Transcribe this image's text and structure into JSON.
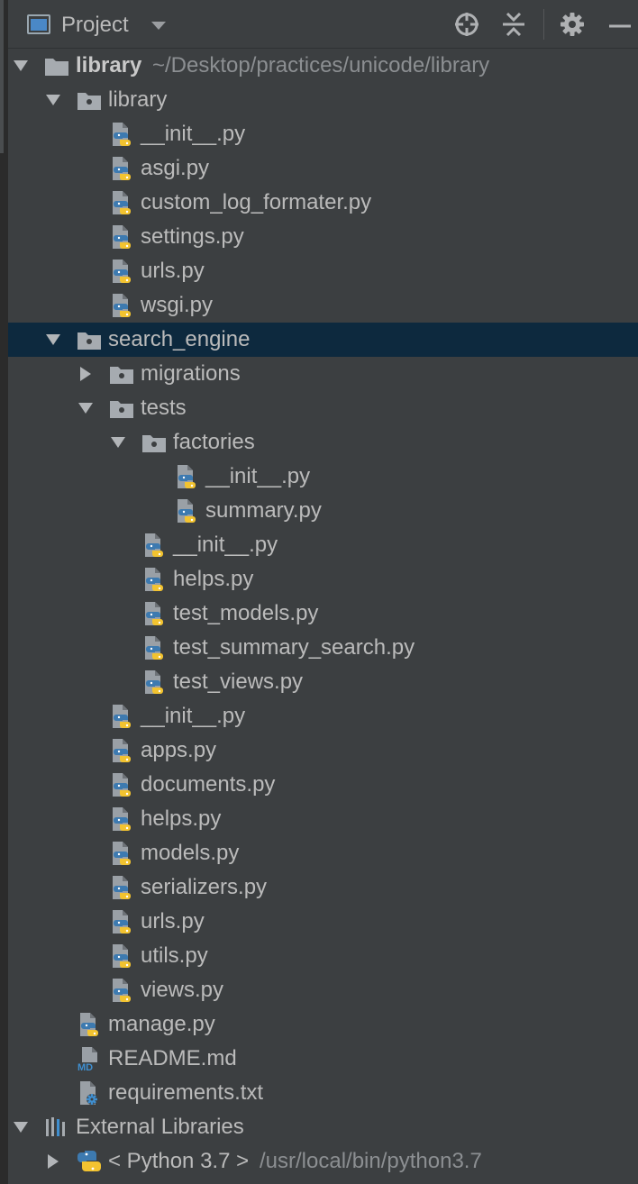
{
  "header": {
    "title": "Project"
  },
  "tree": [
    {
      "label": "library",
      "path": "~/Desktop/practices/unicode/library",
      "depth": 0,
      "icon": "root-folder-icon",
      "arrow": "expanded",
      "bold": true,
      "name": "tree-item-library-root"
    },
    {
      "label": "library",
      "depth": 1,
      "icon": "package-folder-icon",
      "arrow": "expanded",
      "name": "tree-item-library-package"
    },
    {
      "label": "__init__.py",
      "depth": 2,
      "icon": "python-file-icon",
      "name": "tree-item-init-py"
    },
    {
      "label": "asgi.py",
      "depth": 2,
      "icon": "python-file-icon",
      "name": "tree-item-asgi-py"
    },
    {
      "label": "custom_log_formater.py",
      "depth": 2,
      "icon": "python-file-icon",
      "name": "tree-item-custom-log-formater-py"
    },
    {
      "label": "settings.py",
      "depth": 2,
      "icon": "python-file-icon",
      "name": "tree-item-settings-py"
    },
    {
      "label": "urls.py",
      "depth": 2,
      "icon": "python-file-icon",
      "name": "tree-item-urls-py"
    },
    {
      "label": "wsgi.py",
      "depth": 2,
      "icon": "python-file-icon",
      "name": "tree-item-wsgi-py"
    },
    {
      "label": "search_engine",
      "depth": 1,
      "icon": "package-folder-icon",
      "arrow": "expanded",
      "selected": true,
      "name": "tree-item-search-engine"
    },
    {
      "label": "migrations",
      "depth": 2,
      "icon": "package-folder-icon",
      "arrow": "collapsed",
      "name": "tree-item-migrations"
    },
    {
      "label": "tests",
      "depth": 2,
      "icon": "package-folder-icon",
      "arrow": "expanded",
      "name": "tree-item-tests"
    },
    {
      "label": "factories",
      "depth": 3,
      "icon": "package-folder-icon",
      "arrow": "expanded",
      "name": "tree-item-factories"
    },
    {
      "label": "__init__.py",
      "depth": 4,
      "icon": "python-file-icon",
      "name": "tree-item-factories-init-py"
    },
    {
      "label": "summary.py",
      "depth": 4,
      "icon": "python-file-icon",
      "name": "tree-item-summary-py"
    },
    {
      "label": "__init__.py",
      "depth": 3,
      "icon": "python-file-icon",
      "name": "tree-item-tests-init-py"
    },
    {
      "label": "helps.py",
      "depth": 3,
      "icon": "python-file-icon",
      "name": "tree-item-tests-helps-py"
    },
    {
      "label": "test_models.py",
      "depth": 3,
      "icon": "python-file-icon",
      "name": "tree-item-test-models-py"
    },
    {
      "label": "test_summary_search.py",
      "depth": 3,
      "icon": "python-file-icon",
      "name": "tree-item-test-summary-search-py"
    },
    {
      "label": "test_views.py",
      "depth": 3,
      "icon": "python-file-icon",
      "name": "tree-item-test-views-py"
    },
    {
      "label": "__init__.py",
      "depth": 2,
      "icon": "python-file-icon",
      "name": "tree-item-search-engine-init-py"
    },
    {
      "label": "apps.py",
      "depth": 2,
      "icon": "python-file-icon",
      "name": "tree-item-apps-py"
    },
    {
      "label": "documents.py",
      "depth": 2,
      "icon": "python-file-icon",
      "name": "tree-item-documents-py"
    },
    {
      "label": "helps.py",
      "depth": 2,
      "icon": "python-file-icon",
      "name": "tree-item-helps-py"
    },
    {
      "label": "models.py",
      "depth": 2,
      "icon": "python-file-icon",
      "name": "tree-item-models-py"
    },
    {
      "label": "serializers.py",
      "depth": 2,
      "icon": "python-file-icon",
      "name": "tree-item-serializers-py"
    },
    {
      "label": "urls.py",
      "depth": 2,
      "icon": "python-file-icon",
      "name": "tree-item-search-engine-urls-py"
    },
    {
      "label": "utils.py",
      "depth": 2,
      "icon": "python-file-icon",
      "name": "tree-item-utils-py"
    },
    {
      "label": "views.py",
      "depth": 2,
      "icon": "python-file-icon",
      "name": "tree-item-views-py"
    },
    {
      "label": "manage.py",
      "depth": 1,
      "icon": "python-file-icon",
      "name": "tree-item-manage-py"
    },
    {
      "label": "README.md",
      "depth": 1,
      "icon": "markdown-file-icon",
      "name": "tree-item-readme-md"
    },
    {
      "label": "requirements.txt",
      "depth": 1,
      "icon": "requirements-file-icon",
      "name": "tree-item-requirements-txt"
    },
    {
      "label": "External Libraries",
      "depth": 0,
      "icon": "external-libraries-icon",
      "arrow": "expanded",
      "name": "tree-item-external-libraries"
    },
    {
      "label": "< Python 3.7 >",
      "path": "/usr/local/bin/python3.7",
      "depth": 1,
      "icon": "python-sdk-icon",
      "arrow": "collapsed",
      "name": "tree-item-python-sdk"
    }
  ]
}
